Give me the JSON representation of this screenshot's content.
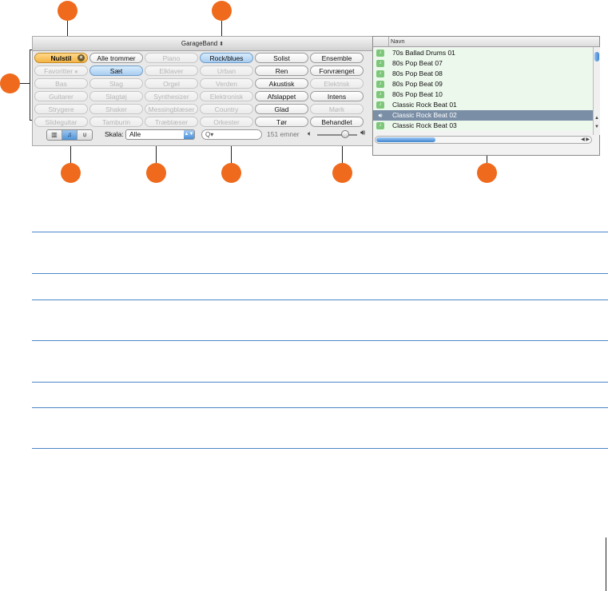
{
  "window": {
    "title": "GarageBand",
    "title_arrows": "⬍"
  },
  "keyword_rows": [
    [
      {
        "label": "Nulstil",
        "state": "orange"
      },
      {
        "label": "Alle trommer",
        "state": "on"
      },
      {
        "label": "Piano",
        "state": "off"
      },
      {
        "label": "Rock/blues",
        "state": "blue"
      },
      {
        "label": "Solist",
        "state": "on"
      },
      {
        "label": "Ensemble",
        "state": "on"
      }
    ],
    [
      {
        "label": "Favoritter",
        "state": "off"
      },
      {
        "label": "Sæt",
        "state": "blue"
      },
      {
        "label": "Elklaver",
        "state": "off"
      },
      {
        "label": "Urban",
        "state": "off"
      },
      {
        "label": "Ren",
        "state": "on"
      },
      {
        "label": "Forvrænget",
        "state": "on"
      }
    ],
    [
      {
        "label": "Bas",
        "state": "off"
      },
      {
        "label": "Slag",
        "state": "off"
      },
      {
        "label": "Orgel",
        "state": "off"
      },
      {
        "label": "Verden",
        "state": "off"
      },
      {
        "label": "Akustisk",
        "state": "on"
      },
      {
        "label": "Elektrisk",
        "state": "off"
      }
    ],
    [
      {
        "label": "Guitarer",
        "state": "off"
      },
      {
        "label": "Slagtøj",
        "state": "off"
      },
      {
        "label": "Synthesizer",
        "state": "off"
      },
      {
        "label": "Elektronisk",
        "state": "off"
      },
      {
        "label": "Afslappet",
        "state": "on"
      },
      {
        "label": "Intens",
        "state": "on"
      }
    ],
    [
      {
        "label": "Strygere",
        "state": "off"
      },
      {
        "label": "Shaker",
        "state": "off"
      },
      {
        "label": "Messingblæser",
        "state": "off"
      },
      {
        "label": "Country",
        "state": "off"
      },
      {
        "label": "Glad",
        "state": "on"
      },
      {
        "label": "Mørk",
        "state": "off"
      }
    ],
    [
      {
        "label": "Slideguitar",
        "state": "off"
      },
      {
        "label": "Tamburin",
        "state": "off"
      },
      {
        "label": "Træblæser",
        "state": "off"
      },
      {
        "label": "Orkester",
        "state": "off"
      },
      {
        "label": "Tør",
        "state": "on"
      },
      {
        "label": "Behandlet",
        "state": "on"
      }
    ]
  ],
  "toolbar": {
    "view_icons": [
      "column-view-icon",
      "note-view-icon",
      "podcast-view-icon"
    ],
    "skala_label": "Skala:",
    "skala_value": "Alle",
    "search_icon": "Q▾",
    "count": "151 emner",
    "volume_level": 0.7
  },
  "browser": {
    "column_header": "Navn",
    "rows": [
      {
        "name": "70s Ballad Drums 01",
        "selected": false
      },
      {
        "name": "80s Pop Beat 07",
        "selected": false
      },
      {
        "name": "80s Pop Beat 08",
        "selected": false
      },
      {
        "name": "80s Pop Beat 09",
        "selected": false
      },
      {
        "name": "80s Pop Beat 10",
        "selected": false
      },
      {
        "name": "Classic Rock Beat 01",
        "selected": false
      },
      {
        "name": "Classic Rock Beat 02",
        "selected": true
      },
      {
        "name": "Classic Rock Beat 03",
        "selected": false
      }
    ]
  },
  "colors": {
    "callout": "#ef6a1c",
    "rule": "#4c86c9",
    "selection": "#7a8ea6",
    "loop_row": "#edf8ec"
  }
}
